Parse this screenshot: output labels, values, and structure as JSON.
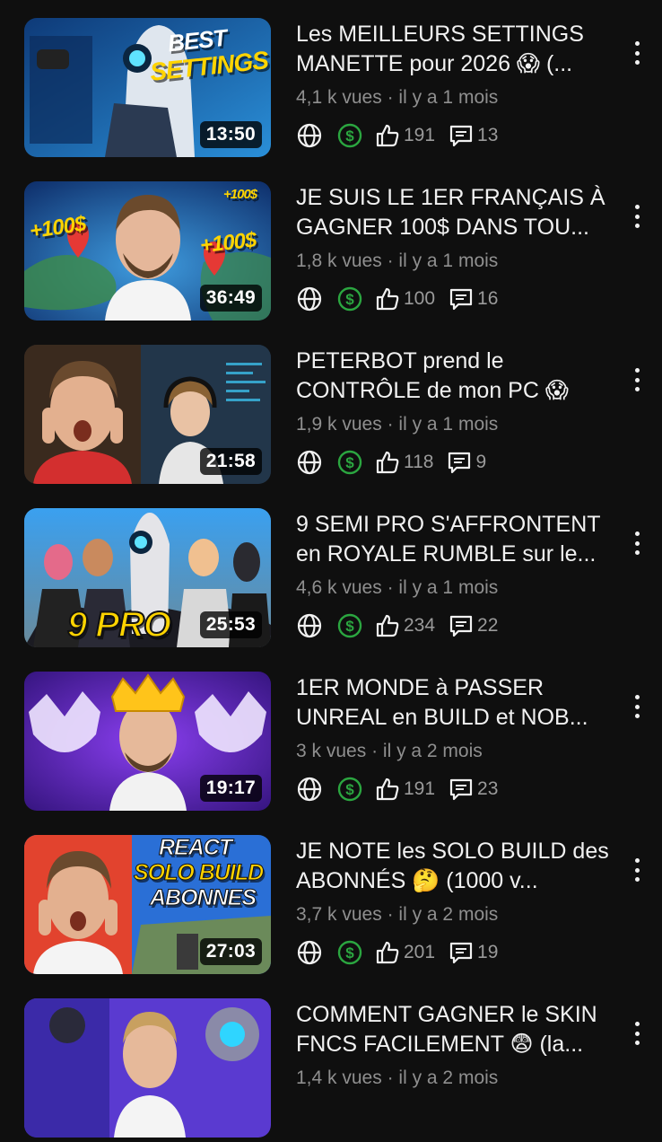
{
  "videos": [
    {
      "title": "Les MEILLEURS SETTINGS MANETTE pour 2026 😱 (...",
      "views": "4,1 k vues",
      "age": "il y a 1 mois",
      "duration": "13:50",
      "likes": "191",
      "comments": "13",
      "thumb_text": "BEST SETTINGS"
    },
    {
      "title": "JE SUIS LE 1ER FRANÇAIS À GAGNER 100$ DANS TOU...",
      "views": "1,8 k vues",
      "age": "il y a 1 mois",
      "duration": "36:49",
      "likes": "100",
      "comments": "16",
      "thumb_text": "+100$"
    },
    {
      "title": "PETERBOT prend le CONTRÔLE de mon PC 😱",
      "views": "1,9 k vues",
      "age": "il y a 1 mois",
      "duration": "21:58",
      "likes": "118",
      "comments": "9",
      "thumb_text": ""
    },
    {
      "title": "9 SEMI PRO S'AFFRONTENT en ROYALE RUMBLE sur le...",
      "views": "4,6 k vues",
      "age": "il y a 1 mois",
      "duration": "25:53",
      "likes": "234",
      "comments": "22",
      "thumb_text": "9 PRO"
    },
    {
      "title": "1ER MONDE à PASSER UNREAL en BUILD et NOB...",
      "views": "3 k vues",
      "age": "il y a 2 mois",
      "duration": "19:17",
      "likes": "191",
      "comments": "23",
      "thumb_text": ""
    },
    {
      "title": "JE NOTE les SOLO BUILD des ABONNÉS 🤔 (1000 v...",
      "views": "3,7 k vues",
      "age": "il y a 2 mois",
      "duration": "27:03",
      "likes": "201",
      "comments": "19",
      "thumb_text": "REACT SOLO BUILD ABONNES"
    },
    {
      "title": "COMMENT GAGNER le SKIN FNCS FACILEMENT 😨 (la...",
      "views": "1,4 k vues",
      "age": "il y a 2 mois",
      "duration": "",
      "likes": "",
      "comments": "",
      "thumb_text": ""
    }
  ],
  "meta_separator": "·",
  "colors": {
    "background": "#0f0f0f",
    "monetized": "#2ba640",
    "text": "#f1f1f1",
    "meta": "#8f8f8f"
  },
  "icons": {
    "visibility": "globe-icon",
    "monetization": "dollar-icon",
    "likes": "thumbs-up-icon",
    "comments": "comment-icon",
    "menu": "more-vert-icon"
  }
}
